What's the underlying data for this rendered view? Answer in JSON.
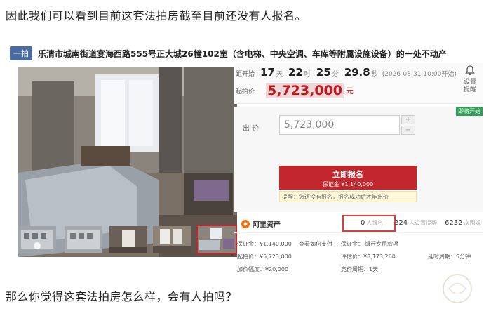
{
  "para1": "因此我们可以看到目前这套法拍房截至目前还没有人报名。",
  "para2": "那么你觉得这套法拍房怎么样，会有人拍吗？",
  "listing": {
    "tag": "一拍",
    "title": "乐清市城南街道宴海西路555号正大城26幢102室（含电梯、中央空调、车库等附属设施设备）的一处不动产"
  },
  "countdown": {
    "label": "距开始",
    "days": "17",
    "days_unit": "天",
    "hours": "22",
    "hours_unit": "时",
    "minutes": "25",
    "minutes_unit": "分",
    "seconds": "29.8",
    "seconds_unit": "秒",
    "start_note": "(2026-08-31 10:00开始)"
  },
  "start_price": {
    "label": "起拍价",
    "value": "5,723,000",
    "unit": "元"
  },
  "settings": {
    "line1": "设置",
    "line2": "提醒",
    "icon": "bell-icon"
  },
  "soon_tag": "即将开始",
  "bid": {
    "label": "出 价",
    "value": "5,723,000",
    "plus": "+",
    "minus": "−"
  },
  "apply": {
    "title": "立即报名",
    "deposit": "保证金 ¥1,140,000"
  },
  "tip": "提醒：您还没有报名，报名成功后才能出价",
  "stats": {
    "brand": "阿里资产",
    "applicants_count": "0",
    "applicants_label": "人报名",
    "reminders_count": "224",
    "reminders_label": "人设置提醒",
    "views_count": "6232",
    "views_label": "次围观"
  },
  "details": {
    "deposit": "保证金：¥1,140,000",
    "pay_link": "查看如何支付",
    "pay_label": "保证金：",
    "bank_link": "银行专用款项",
    "start_price": "起拍价：¥5,723,000",
    "assessment": "评估价：¥8,173,260",
    "delay": "延时周期：5分钟",
    "increment": "加价幅度：¥20,000",
    "cycle": "竞价周期：1天"
  },
  "colors": {
    "accent": "#c1272d",
    "tag_blue": "#4a6aa0",
    "brand_orange": "#ff6a00",
    "link": "#3a6fc8"
  }
}
